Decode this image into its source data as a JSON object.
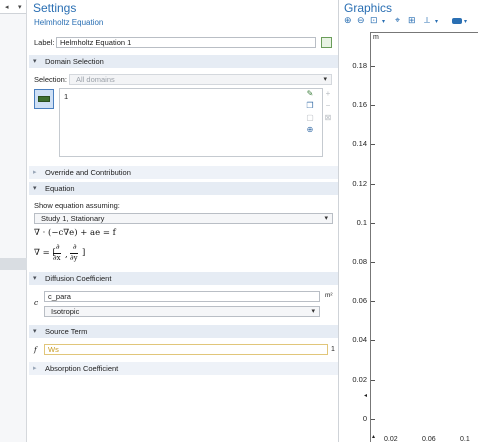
{
  "settings": {
    "title": "Settings",
    "subtitle": "Helmholtz Equation",
    "label_caption": "Label:",
    "label_value": "Helmholtz Equation 1",
    "domain_selection": {
      "header": "Domain Selection",
      "selection_caption": "Selection:",
      "selection_value": "All domains",
      "list_items": [
        "1"
      ]
    },
    "override": {
      "header": "Override and Contribution"
    },
    "equation": {
      "header": "Equation",
      "show_caption": "Show equation assuming:",
      "study_value": "Study 1, Stationary",
      "eq1": "∇ · (−c∇e) + ae = f",
      "eq2_prefix": "∇ = [",
      "eq2_d1": "∂",
      "eq2_x": "∂x",
      "eq2_sep": ",",
      "eq2_d2": "∂",
      "eq2_y": "∂y",
      "eq2_suffix": "]"
    },
    "diffusion": {
      "header": "Diffusion Coefficient",
      "symbol": "c",
      "value": "c_para",
      "unit": "m²",
      "type_value": "Isotropic"
    },
    "source": {
      "header": "Source Term",
      "symbol": "f",
      "value": "Ws",
      "unit": "1"
    },
    "absorption": {
      "header": "Absorption Coefficient"
    }
  },
  "graphics": {
    "title": "Graphics",
    "axis_unit": "m",
    "y_ticks": [
      "0.18",
      "0.16",
      "0.14",
      "0.12",
      "0.1",
      "0.08",
      "0.06",
      "0.04",
      "0.02",
      "0"
    ],
    "x_ticks": [
      "0.02",
      "0.06",
      "0.1"
    ]
  },
  "colors": {
    "accent": "#2a6fb3",
    "section_bg": "#e6ecf4",
    "source_text": "#c89a1e"
  }
}
